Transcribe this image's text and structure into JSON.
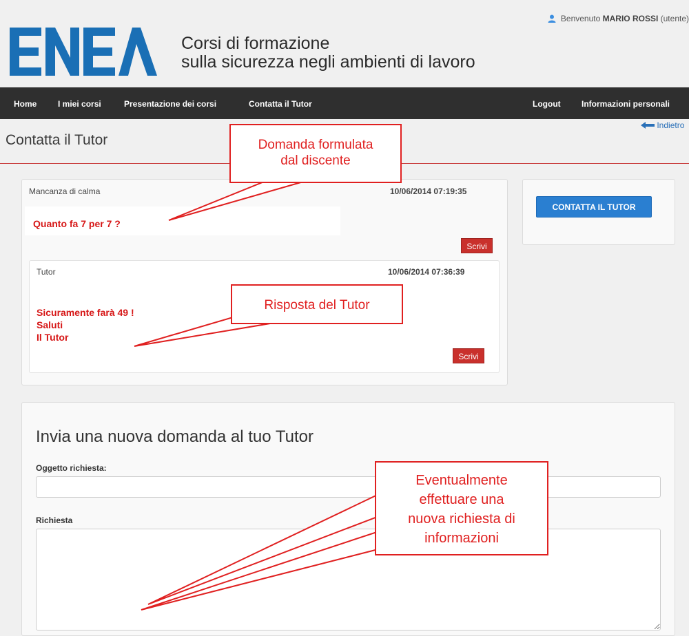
{
  "header": {
    "welcome_prefix": "Benvenuto",
    "user_name": "MARIO ROSSI",
    "user_role": "(utente)",
    "logo_text": "ENEA",
    "title_line1": "Corsi di formazione",
    "title_line2": "sulla sicurezza negli ambienti di lavoro"
  },
  "nav": {
    "home": "Home",
    "my_courses": "I miei corsi",
    "courses_presentation": "Presentazione dei corsi",
    "contact_tutor": "Contatta il Tutor",
    "logout": "Logout",
    "personal_info": "Informazioni personali"
  },
  "page": {
    "title": "Contatta il Tutor",
    "back_label": "Indietro"
  },
  "thread": {
    "question": {
      "subject": "Mancanza di calma",
      "date": "10/06/2014 07:19:35",
      "body": "Quanto fa 7 per 7 ?",
      "write_label": "Scrivi"
    },
    "reply": {
      "author": "Tutor",
      "date": "10/06/2014 07:36:39",
      "line1": "Sicuramente farà 49 !",
      "line2": "Saluti",
      "line3": "Il Tutor",
      "write_label": "Scrivi"
    }
  },
  "sidebar": {
    "contact_button": "CONTATTA IL TUTOR"
  },
  "form": {
    "title": "Invia una nuova domanda al tuo Tutor",
    "subject_label": "Oggetto richiesta:",
    "subject_value": "",
    "request_label": "Richiesta",
    "request_value": ""
  },
  "annotations": {
    "question_callout_line1": "Domanda formulata",
    "question_callout_line2": "dal discente",
    "reply_callout": "Risposta del Tutor",
    "request_callout_line1": "Eventualmente",
    "request_callout_line2": "effettuare una",
    "request_callout_line3": "nuova richiesta di",
    "request_callout_line4": "informazioni"
  },
  "colors": {
    "nav_bg": "#2f2f2f",
    "accent_red": "#e02020",
    "button_blue": "#2a7fd1",
    "logo_blue": "#1a6fb5"
  }
}
